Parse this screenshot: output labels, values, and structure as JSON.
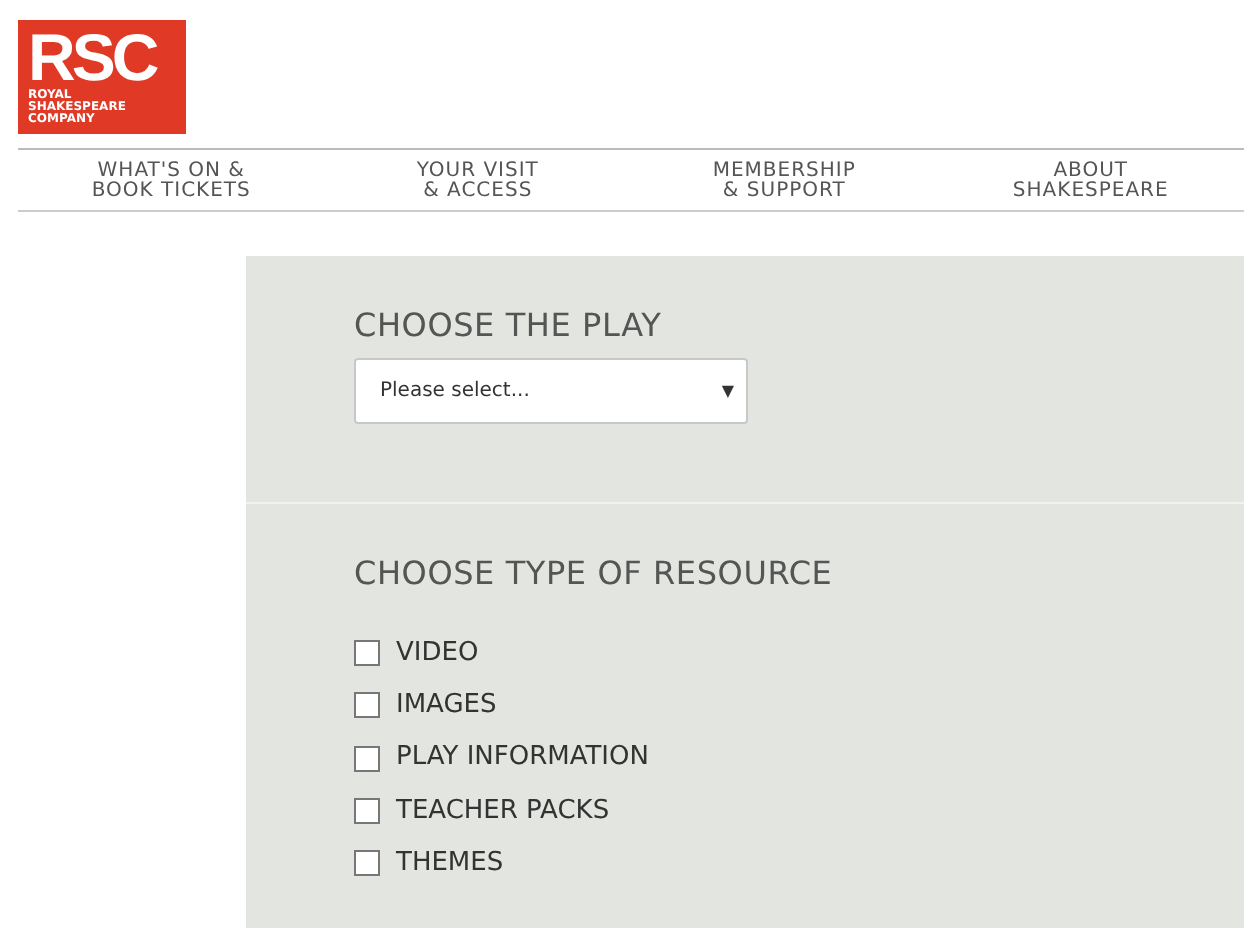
{
  "logo": {
    "initials": "RSC",
    "name_lines": [
      "ROYAL",
      "SHAKESPEARE",
      "COMPANY"
    ]
  },
  "nav": [
    {
      "lines": [
        "WHAT'S ON &",
        "BOOK TICKETS"
      ]
    },
    {
      "lines": [
        "YOUR VISIT",
        "& ACCESS"
      ]
    },
    {
      "lines": [
        "MEMBERSHIP",
        "& SUPPORT"
      ]
    },
    {
      "lines": [
        "ABOUT",
        "SHAKESPEARE"
      ]
    }
  ],
  "play_section": {
    "title": "CHOOSE THE PLAY",
    "select": {
      "value": "Please select...",
      "arrow": "▼"
    }
  },
  "resource_section": {
    "title": "CHOOSE TYPE OF RESOURCE",
    "options": [
      {
        "label": "VIDEO",
        "checked": false
      },
      {
        "label": "IMAGES",
        "checked": false
      },
      {
        "label": "PLAY INFORMATION",
        "checked": false
      },
      {
        "label": "TEACHER PACKS",
        "checked": false
      },
      {
        "label": "THEMES",
        "checked": false
      }
    ]
  }
}
